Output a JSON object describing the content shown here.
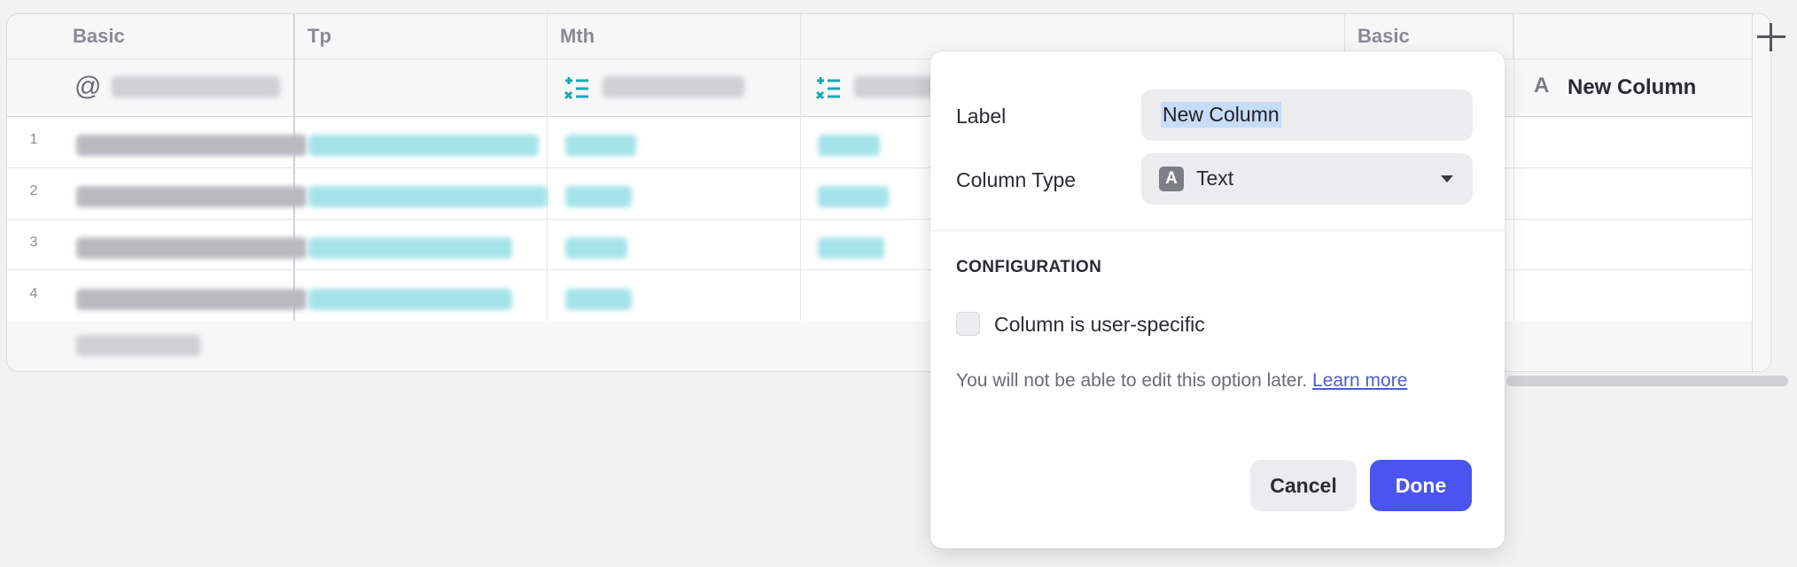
{
  "grid": {
    "groups": [
      "Basic",
      "Tp",
      "Mth",
      "Basic"
    ],
    "rows": [
      "1",
      "2",
      "3",
      "4"
    ],
    "new_column_header": "New Column",
    "new_column_type_glyph": "A"
  },
  "popover": {
    "label_field": "Label",
    "label_value": "New Column",
    "type_field": "Column Type",
    "type_glyph": "A",
    "type_value": "Text",
    "section_title": "CONFIGURATION",
    "checkbox_label": "Column is user-specific",
    "checkbox_checked": false,
    "help_text": "You will not be able to edit this option later.",
    "help_link": "Learn more",
    "cancel_label": "Cancel",
    "done_label": "Done"
  },
  "colors": {
    "accent": "#4a55ef",
    "link": "#4f5bd5",
    "teal": "#1ba8b4"
  },
  "icons": [
    "at-icon",
    "formula-icon",
    "text-type-icon",
    "chevron-down-icon",
    "plus-icon"
  ]
}
